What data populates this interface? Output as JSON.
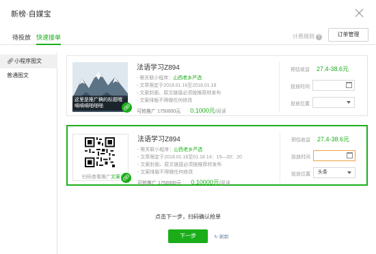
{
  "dialog": {
    "title": "新榜·自媒宝"
  },
  "tabs": [
    {
      "label": "待投放"
    },
    {
      "label": "快速接单"
    }
  ],
  "toolbar": {
    "rules_label": "计费规则",
    "rules_help": "?",
    "order_button": "订单管理"
  },
  "sidebar": {
    "items": [
      {
        "icon": "link-icon",
        "label": "小程序图文",
        "active": true
      },
      {
        "label": "普通图文"
      }
    ]
  },
  "cards": [
    {
      "name": "法语学习Z894",
      "thumb_caption": "这里是推广稿的标题哦嘀嘀嘀啪啪啪",
      "lines": [
        {
          "prefix": "- 需关联小程序：",
          "highlight": "山西老乡严选"
        },
        {
          "prefix": "- 文章限定于2018.01.16至2018.01.18"
        },
        {
          "prefix": "- 文案封面、原文链接必须按推荐材发布"
        },
        {
          "prefix": "- 文案排版不得做任何修改"
        }
      ],
      "bid_label": "可抢推广 1750000元",
      "price": "0.1000元",
      "price_unit": "/阅读",
      "earn_label": "预估收益",
      "earn_value": "27.4-38.6元",
      "time_label": "投放时间",
      "time_value": "",
      "pos_label": "投放位置",
      "pos_value": ""
    },
    {
      "name": "法语学习Z894",
      "qr_caption_a": "扫码查看推广",
      "qr_caption_b": "文案",
      "lines": [
        {
          "prefix": "- 需关联小程序：",
          "highlight": "山西老乡严选"
        },
        {
          "prefix": "- 文章限定于2018.01.16至01.18  14：15—20：20"
        },
        {
          "prefix": "- 文案封面、原文链接必须按推荐材发布"
        },
        {
          "prefix": "- 文案排版不得做任何修改"
        }
      ],
      "bid_label": "可抢推广 1750000元",
      "price": "0.10000元",
      "price_unit": "/阅读",
      "earn_label": "预估收益",
      "earn_value": "27.4-38.6元",
      "time_label": "投放时间",
      "time_value": "",
      "pos_label": "投放位置",
      "pos_value": "头条"
    }
  ],
  "footer": {
    "hint": "点击下一步，扫码确认抢单",
    "next_button": "下一步",
    "refresh_label": "刷新"
  },
  "colors": {
    "accent": "#1aad19",
    "focus": "#f0a040"
  }
}
